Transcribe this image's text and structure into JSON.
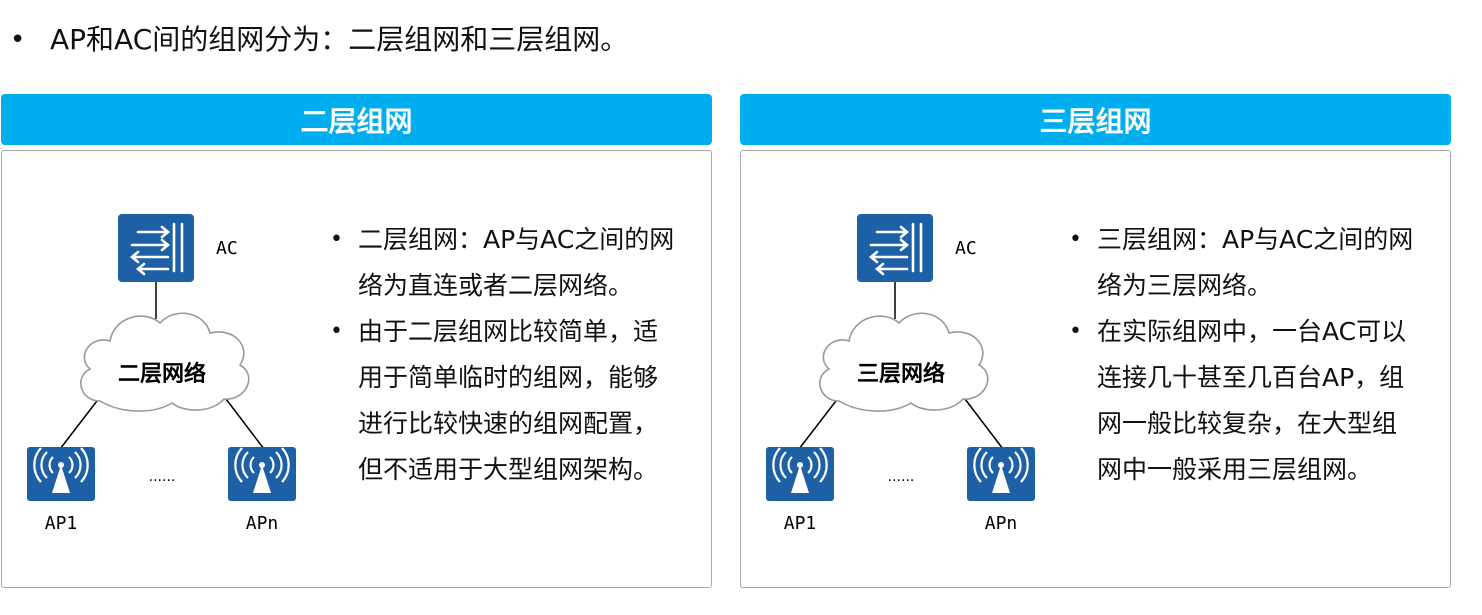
{
  "intro": {
    "bullet": "•",
    "text": "AP和AC间的组网分为：二层组网和三层组网。"
  },
  "colors": {
    "header_bg": "#00aeef",
    "device_bg": "#1d60a6",
    "cloud_stroke": "#999999"
  },
  "panels": [
    {
      "title": "二层组网",
      "diagram": {
        "ac_label": "AC",
        "cloud_label": "二层网络",
        "ap_left_label": "AP1",
        "ap_right_label": "APn",
        "ellipsis": "......",
        "icons": {
          "ac": "switch-icon",
          "ap": "wireless-ap-icon",
          "cloud": "cloud-icon"
        }
      },
      "desc": [
        {
          "bullet": "•",
          "lines": [
            "二层组网：AP与AC之间的网",
            "络为直连或者二层网络。"
          ]
        },
        {
          "bullet": "•",
          "lines": [
            "由于二层组网比较简单，适",
            "用于简单临时的组网，能够",
            "进行比较快速的组网配置，",
            "但不适用于大型组网架构。"
          ]
        }
      ]
    },
    {
      "title": "三层组网",
      "diagram": {
        "ac_label": "AC",
        "cloud_label": "三层网络",
        "ap_left_label": "AP1",
        "ap_right_label": "APn",
        "ellipsis": "......",
        "icons": {
          "ac": "switch-icon",
          "ap": "wireless-ap-icon",
          "cloud": "cloud-icon"
        }
      },
      "desc": [
        {
          "bullet": "•",
          "lines": [
            "三层组网：AP与AC之间的网",
            "络为三层网络。"
          ]
        },
        {
          "bullet": "•",
          "lines": [
            "在实际组网中，一台AC可以",
            "连接几十甚至几百台AP，组",
            "网一般比较复杂，在大型组",
            "网中一般采用三层组网。"
          ]
        }
      ]
    }
  ]
}
